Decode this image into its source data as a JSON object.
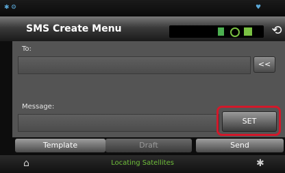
{
  "header": {
    "title": "SMS Create Menu",
    "back_icon": "back-icon"
  },
  "form": {
    "to_label": "To:",
    "to_value": "",
    "backspace_label": "<<",
    "message_label": "Message:",
    "message_value": "",
    "set_label": "SET"
  },
  "actions": {
    "template_label": "Template",
    "draft_label": "Draft",
    "send_label": "Send"
  },
  "footer": {
    "status_text": "Locating Satellites"
  },
  "colors": {
    "highlight": "#d2182a",
    "status_green": "#6fbf3a",
    "accent_blue": "#5aa8d8"
  }
}
